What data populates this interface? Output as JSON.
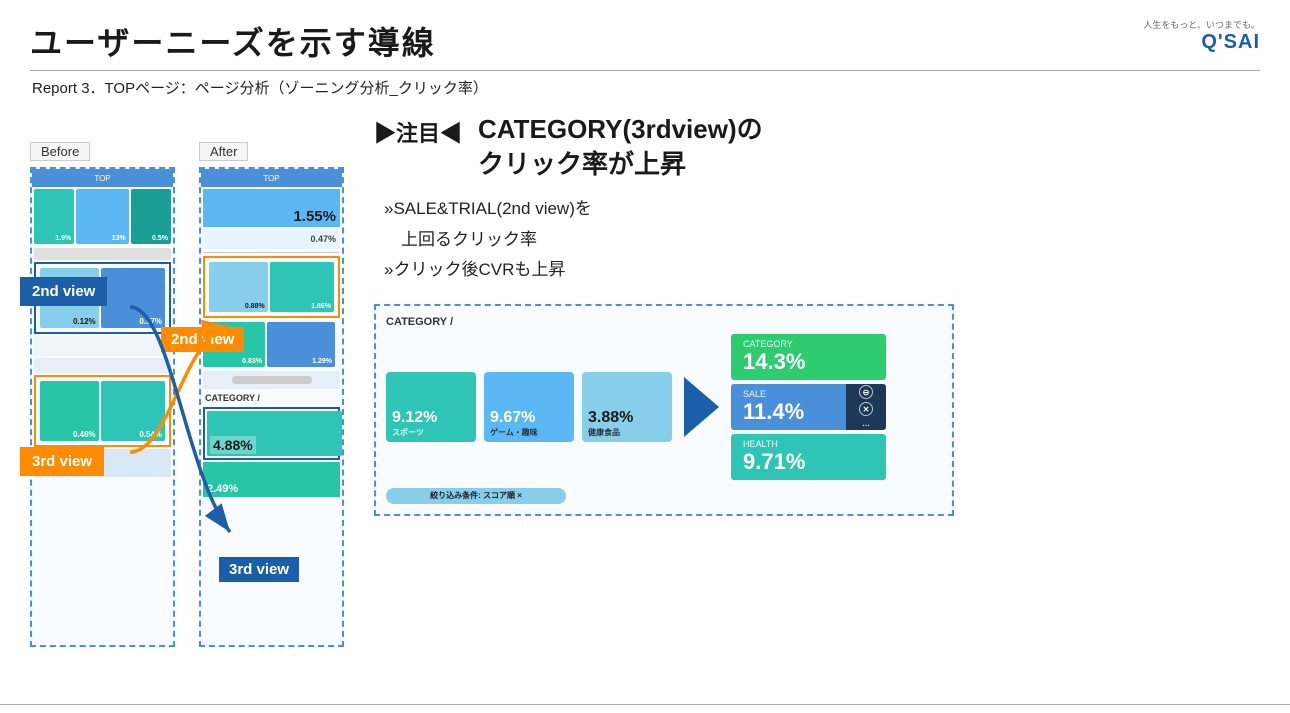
{
  "header": {
    "main_title": "ユーザーニーズを示す導線",
    "logo_caption": "人生をもっと、いつまでも。",
    "logo_text": "Q'SAI"
  },
  "subtitle": "Report 3．TOPページ：ページ分析（ゾーニング分析_クリック率）",
  "before_label": "Before",
  "after_label": "After",
  "view_labels": {
    "before_2nd": "2nd view",
    "before_3rd": "3rd view",
    "after_2nd": "2nd view",
    "after_3rd": "3rd view"
  },
  "attention": "▶注目◀",
  "main_insight": "CATEGORY(3rdview)の\nクリック率が上昇",
  "sub_insights": [
    "»SALE&TRIAL(2nd view)を",
    "　上回るクリック率",
    "»クリック後CVRも上昇"
  ],
  "category_label": "CATEGORY /",
  "before_data": {
    "row1": [
      "1.9%",
      "13%",
      "0.5%"
    ],
    "row2": [
      "0.12%",
      "0.57%"
    ],
    "row3": [
      "0.48%",
      "0.54%"
    ]
  },
  "after_data": {
    "top_pct": "1.55%",
    "sub_pct": "0.47%",
    "row2": [
      "0.88%",
      "1.86%"
    ],
    "row3": [
      "0.83%",
      "1.29%"
    ],
    "cat_pct": "4.88%",
    "bottom_pct": "2.49%"
  },
  "category_items": [
    {
      "pct": "9.12%",
      "color": "#2ec4b6"
    },
    {
      "pct": "9.67%",
      "color": "#5bb8f5"
    },
    {
      "pct": "3.88%",
      "color": "#87ceeb"
    }
  ],
  "results": [
    {
      "label": "CATEGORY",
      "pct": "14.3%",
      "color": "#2ecc71"
    },
    {
      "label": "SALE",
      "pct": "11.4%",
      "color": "#4a90d9",
      "has_overlay": true
    },
    {
      "label": "HEALTH",
      "pct": "9.71%",
      "color": "#2ec4b6"
    }
  ]
}
